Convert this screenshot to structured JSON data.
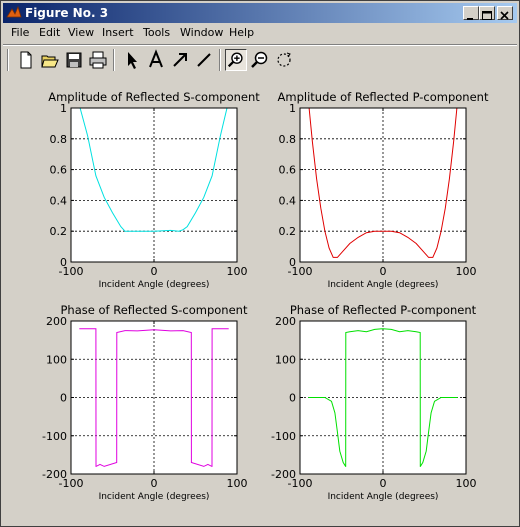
{
  "window": {
    "title": "Figure No. 3"
  },
  "menu": [
    "File",
    "Edit",
    "View",
    "Insert",
    "Tools",
    "Window",
    "Help"
  ],
  "toolbar": [
    "new-file-icon",
    "open-folder-icon",
    "save-icon",
    "print-icon",
    "select-arrow-icon",
    "insert-text-icon",
    "insert-arrow-icon",
    "insert-line-icon",
    "zoom-in-icon",
    "zoom-out-icon",
    "rotate-3d-icon"
  ],
  "chart_data": [
    {
      "type": "line",
      "title": "Amplitude of Reflected S-component",
      "xlabel": "Incident Angle (degrees)",
      "ylabel": "",
      "xlim": [
        -100,
        100
      ],
      "ylim": [
        0,
        1
      ],
      "xticks": [
        -100,
        0,
        100
      ],
      "yticks": [
        0,
        0.2,
        0.4,
        0.6,
        0.8,
        1
      ],
      "ytick_labels": [
        "0",
        "0.2",
        "0.4",
        "0.6",
        "0.8",
        "1"
      ],
      "grid": true,
      "color": "#00e0e0",
      "x": [
        -89,
        -80,
        -70,
        -60,
        -50,
        -40,
        -35,
        -20,
        0,
        20,
        30,
        35,
        40,
        50,
        60,
        70,
        80,
        88
      ],
      "y": [
        1.0,
        0.82,
        0.56,
        0.42,
        0.32,
        0.23,
        0.2,
        0.2,
        0.2,
        0.205,
        0.2,
        0.21,
        0.23,
        0.32,
        0.42,
        0.56,
        0.82,
        1.0
      ]
    },
    {
      "type": "line",
      "title": "Amplitude of Reflected P-component",
      "xlabel": "Incident Angle (degrees)",
      "ylabel": "",
      "xlim": [
        -100,
        100
      ],
      "ylim": [
        0,
        1
      ],
      "xticks": [
        -100,
        0,
        100
      ],
      "yticks": [
        0,
        0.2,
        0.4,
        0.6,
        0.8,
        1
      ],
      "ytick_labels": [
        "0",
        "0.2",
        "0.4",
        "0.6",
        "0.8",
        "1"
      ],
      "grid": true,
      "color": "#e00000",
      "x": [
        -89,
        -85,
        -80,
        -75,
        -70,
        -65,
        -60,
        -55,
        -50,
        -40,
        -30,
        -20,
        -10,
        0,
        10,
        20,
        30,
        40,
        50,
        55,
        60,
        65,
        70,
        75,
        80,
        85,
        89
      ],
      "y": [
        1.0,
        0.78,
        0.54,
        0.35,
        0.2,
        0.09,
        0.03,
        0.03,
        0.06,
        0.12,
        0.16,
        0.19,
        0.2,
        0.2,
        0.2,
        0.19,
        0.16,
        0.12,
        0.06,
        0.03,
        0.03,
        0.09,
        0.2,
        0.35,
        0.54,
        0.78,
        1.0
      ]
    },
    {
      "type": "line",
      "title": "Phase of Reflected S-component",
      "xlabel": "Incident Angle (degrees)",
      "ylabel": "",
      "xlim": [
        -100,
        100
      ],
      "ylim": [
        -200,
        200
      ],
      "xticks": [
        -100,
        0,
        100
      ],
      "yticks": [
        -200,
        -100,
        0,
        100,
        200
      ],
      "ytick_labels": [
        "-200",
        "-100",
        "0",
        "100",
        "200"
      ],
      "grid": true,
      "color": "#e000e0",
      "x": [
        -90,
        -70,
        -69.9,
        -69.8,
        -65,
        -60,
        -45,
        -44.9,
        -44.8,
        -35,
        -20,
        0,
        20,
        35,
        45,
        45.1,
        45.2,
        60,
        65,
        69.8,
        69.9,
        70,
        90
      ],
      "y": [
        180,
        180,
        -180,
        -180,
        -175,
        -180,
        -170,
        -170,
        170,
        175,
        174,
        177,
        174,
        175,
        170,
        -170,
        -170,
        -180,
        -175,
        -180,
        -180,
        180,
        180
      ]
    },
    {
      "type": "line",
      "title": "Phase of Reflected P-component",
      "xlabel": "Incident Angle (degrees)",
      "ylabel": "",
      "xlim": [
        -100,
        100
      ],
      "ylim": [
        -200,
        200
      ],
      "xticks": [
        -100,
        0,
        100
      ],
      "yticks": [
        -200,
        -100,
        0,
        100,
        200
      ],
      "ytick_labels": [
        "-200",
        "-100",
        "0",
        "100",
        "200"
      ],
      "grid": true,
      "color": "#00e000",
      "x": [
        -90,
        -70,
        -62,
        -58,
        -55,
        -52,
        -48,
        -45,
        -44.9,
        -44.8,
        -40,
        -30,
        -20,
        -10,
        0,
        10,
        20,
        30,
        40,
        44.8,
        44.9,
        45,
        48,
        52,
        55,
        58,
        62,
        70,
        90
      ],
      "y": [
        0,
        0,
        -10,
        -40,
        -90,
        -140,
        -170,
        -180,
        -180,
        170,
        172,
        175,
        172,
        178,
        180,
        178,
        172,
        175,
        172,
        170,
        -180,
        -180,
        -170,
        -140,
        -90,
        -40,
        -10,
        0,
        0
      ]
    }
  ]
}
